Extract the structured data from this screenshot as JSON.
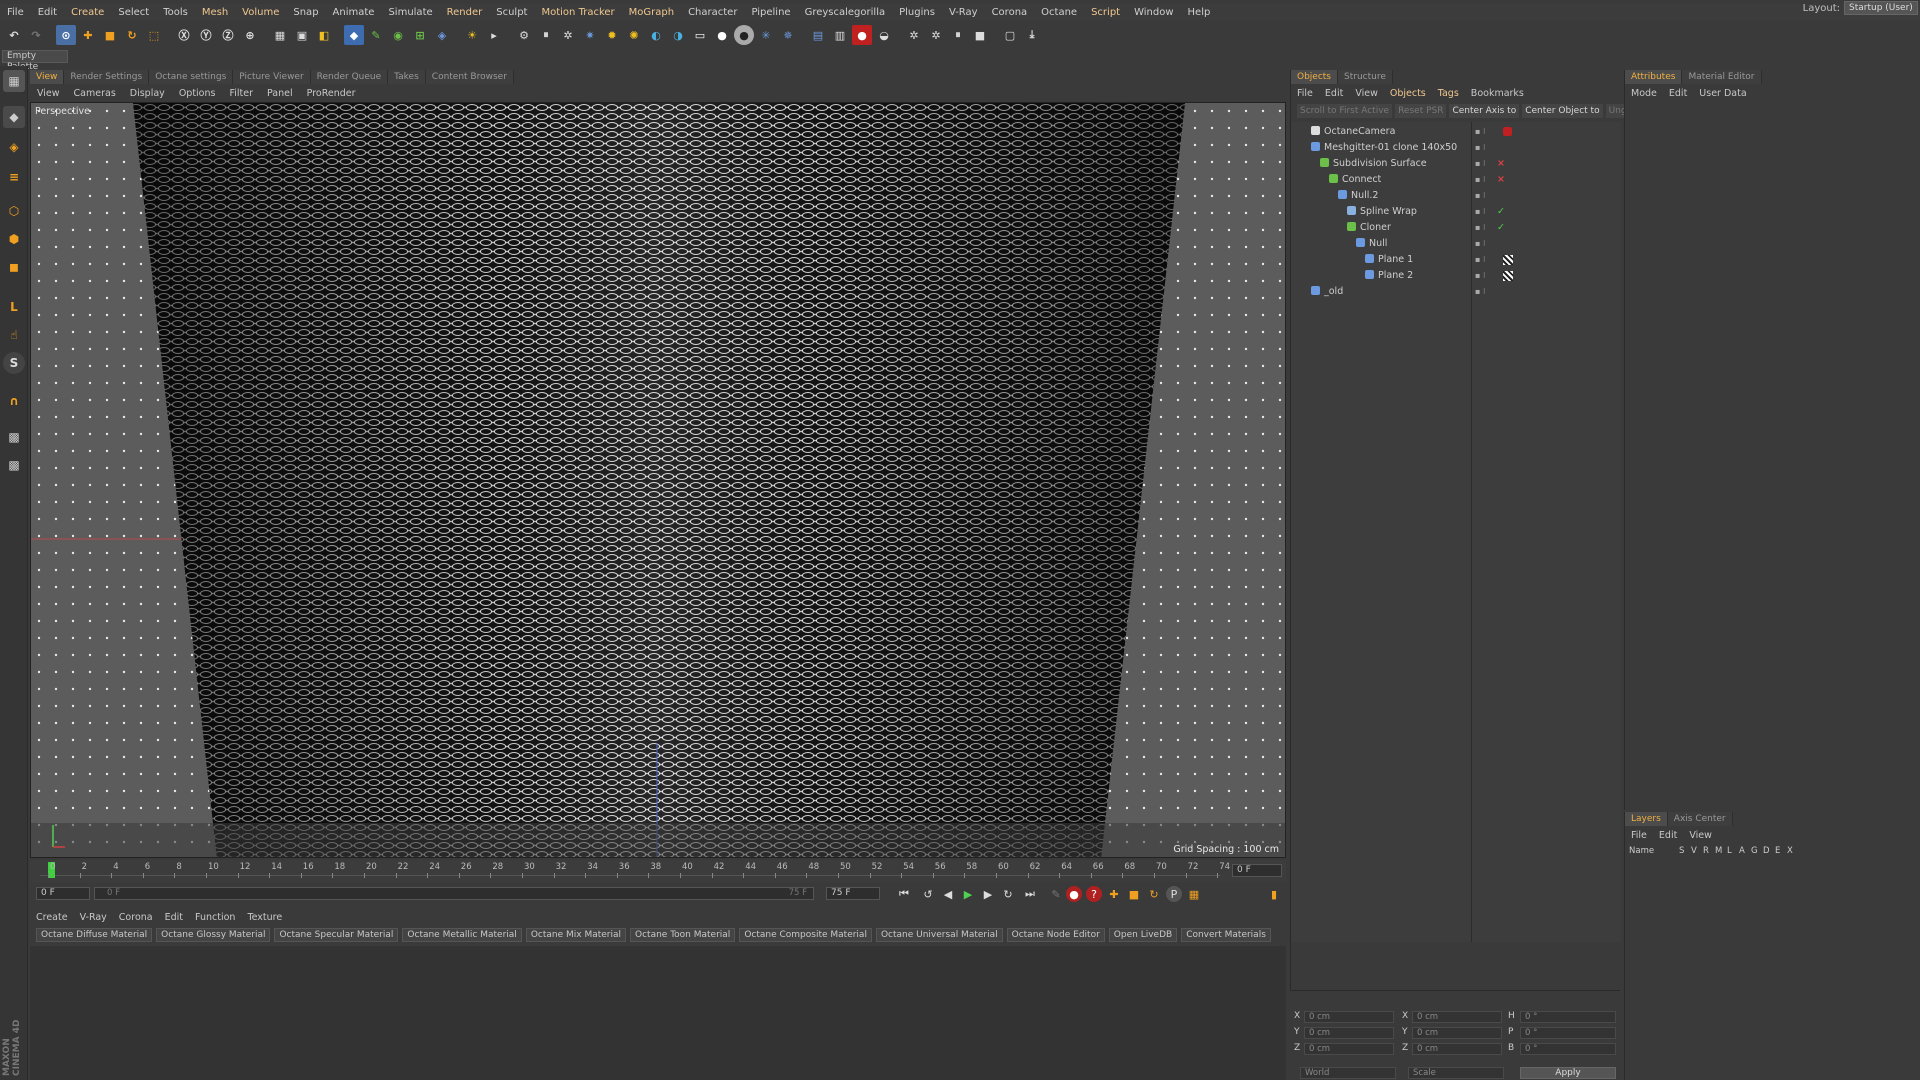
{
  "menubar": {
    "items": [
      "File",
      "Edit",
      "Create",
      "Select",
      "Tools",
      "Mesh",
      "Volume",
      "Snap",
      "Animate",
      "Simulate",
      "Render",
      "Sculpt",
      "Motion Tracker",
      "MoGraph",
      "Character",
      "Pipeline",
      "Greyscalegorilla",
      "Plugins",
      "V-Ray",
      "Corona",
      "Octane",
      "Script",
      "Window",
      "Help"
    ],
    "layout_label": "Layout:",
    "layout_value": "Startup (User)"
  },
  "palette": {
    "label": "Empty Palette"
  },
  "viewport_tabs": [
    "View",
    "Render Settings",
    "Octane settings",
    "Picture Viewer",
    "Render Queue",
    "Takes",
    "Content Browser"
  ],
  "viewport_menu": [
    "View",
    "Cameras",
    "Display",
    "Options",
    "Filter",
    "Panel",
    "ProRender"
  ],
  "viewport": {
    "label": "Perspective",
    "grid_spacing": "Grid Spacing : 100 cm"
  },
  "timeline": {
    "ticks": [
      "0",
      "2",
      "4",
      "6",
      "8",
      "10",
      "12",
      "14",
      "16",
      "18",
      "20",
      "22",
      "24",
      "26",
      "28",
      "30",
      "32",
      "34",
      "36",
      "38",
      "40",
      "42",
      "44",
      "46",
      "48",
      "50",
      "52",
      "54",
      "56",
      "58",
      "60",
      "62",
      "64",
      "66",
      "68",
      "70",
      "72",
      "74"
    ],
    "frame": "0 F",
    "start": "0 F",
    "slider_start": "0 F",
    "slider_end": "75 F",
    "end": "75 F"
  },
  "material_menu": [
    "Create",
    "V-Ray",
    "Corona",
    "Edit",
    "Function",
    "Texture"
  ],
  "material_buttons": [
    "Octane Diffuse Material",
    "Octane Glossy Material",
    "Octane Specular Material",
    "Octane Metallic Material",
    "Octane Mix Material",
    "Octane Toon Material",
    "Octane Composite Material",
    "Octane Universal Material",
    "Octane Node Editor",
    "Open LiveDB",
    "Convert Materials"
  ],
  "objects_panel": {
    "tabs": [
      "Objects",
      "Structure"
    ],
    "menu": [
      "File",
      "Edit",
      "View",
      "Objects",
      "Tags",
      "Bookmarks"
    ],
    "toolbar": [
      "Scroll to First Active",
      "Reset PSR",
      "Center Axis to",
      "Center Object to",
      "Unglue"
    ],
    "rows": [
      {
        "name": "OctaneCamera",
        "indent": 0
      },
      {
        "name": "Meshgitter-01 clone 140x50",
        "indent": 0
      },
      {
        "name": "Subdivision Surface",
        "indent": 1
      },
      {
        "name": "Connect",
        "indent": 2
      },
      {
        "name": "Null.2",
        "indent": 3
      },
      {
        "name": "Spline Wrap",
        "indent": 4
      },
      {
        "name": "Cloner",
        "indent": 4
      },
      {
        "name": "Null",
        "indent": 5
      },
      {
        "name": "Plane 1",
        "indent": 6
      },
      {
        "name": "Plane 2",
        "indent": 6
      },
      {
        "name": "_old",
        "indent": 0
      }
    ]
  },
  "coords": {
    "rows": [
      {
        "a": "X",
        "av": "0 cm",
        "b": "X",
        "bv": "0 cm",
        "c": "H",
        "cv": "0 °"
      },
      {
        "a": "Y",
        "av": "0 cm",
        "b": "Y",
        "bv": "0 cm",
        "c": "P",
        "cv": "0 °"
      },
      {
        "a": "Z",
        "av": "0 cm",
        "b": "Z",
        "bv": "0 cm",
        "c": "B",
        "cv": "0 °"
      }
    ],
    "world": "World",
    "scale": "Scale",
    "apply": "Apply"
  },
  "attributes_panel": {
    "tabs": [
      "Attributes",
      "Material Editor"
    ],
    "menu": [
      "Mode",
      "Edit",
      "User Data"
    ]
  },
  "layers_panel": {
    "tabs": [
      "Layers",
      "Axis Center"
    ],
    "menu": [
      "File",
      "Edit",
      "View"
    ],
    "columns": [
      "Name",
      "S",
      "V",
      "R",
      "M",
      "L",
      "A",
      "G",
      "D",
      "E",
      "X"
    ]
  },
  "branding": "MAXON CINEMA 4D"
}
